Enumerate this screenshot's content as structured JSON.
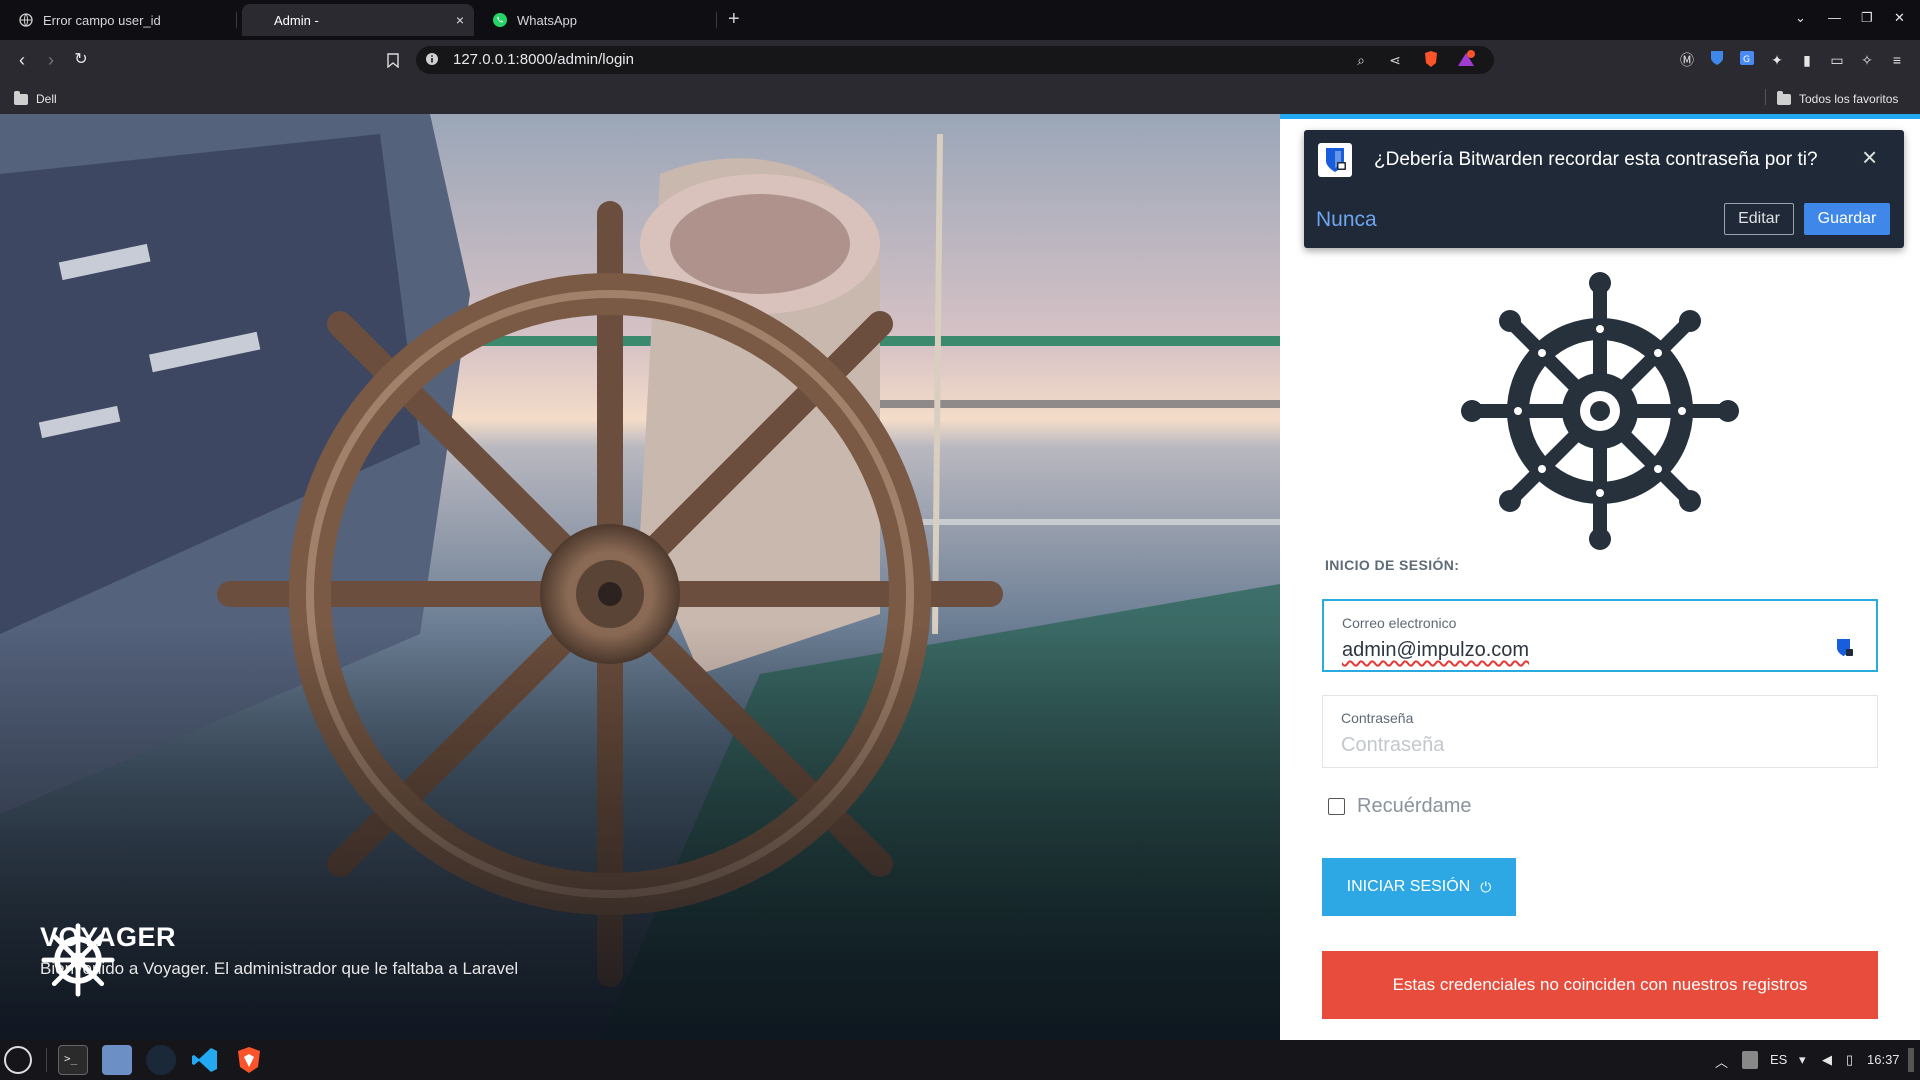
{
  "tabs": [
    {
      "title": "Error campo user_id",
      "icon": "globe-icon"
    },
    {
      "title": "Admin -",
      "icon": "none",
      "close": "×"
    },
    {
      "title": "WhatsApp",
      "icon": "whatsapp-icon"
    }
  ],
  "new_tab": "+",
  "address": {
    "url": "127.0.0.1:8000/admin/login"
  },
  "bookmarks": {
    "left": "Dell",
    "right": "Todos los favoritos"
  },
  "hero": {
    "title": "VOYAGER",
    "subtitle": "Bienvenido a Voyager. El administrador que le faltaba a Laravel"
  },
  "bitwarden": {
    "question": "¿Debería Bitwarden recordar esta contraseña por ti?",
    "never": "Nunca",
    "edit": "Editar",
    "save": "Guardar",
    "close": "×"
  },
  "login": {
    "heading": "INICIO DE SESIÓN:",
    "email_label": "Correo electronico",
    "email_value": "admin@impulzo.com",
    "password_label": "Contraseña",
    "password_placeholder": "Contraseña",
    "remember": "Recuérdame",
    "submit": "INICIAR SESIÓN",
    "error": "Estas credenciales no coinciden con nuestros registros"
  },
  "taskbar": {
    "lang": "ES",
    "time": "16:37"
  },
  "colors": {
    "accent": "#22a7f0",
    "error": "#e74c3c",
    "bitwarden_bg": "#1f2937",
    "bitwarden_blue": "#3f87e9"
  }
}
